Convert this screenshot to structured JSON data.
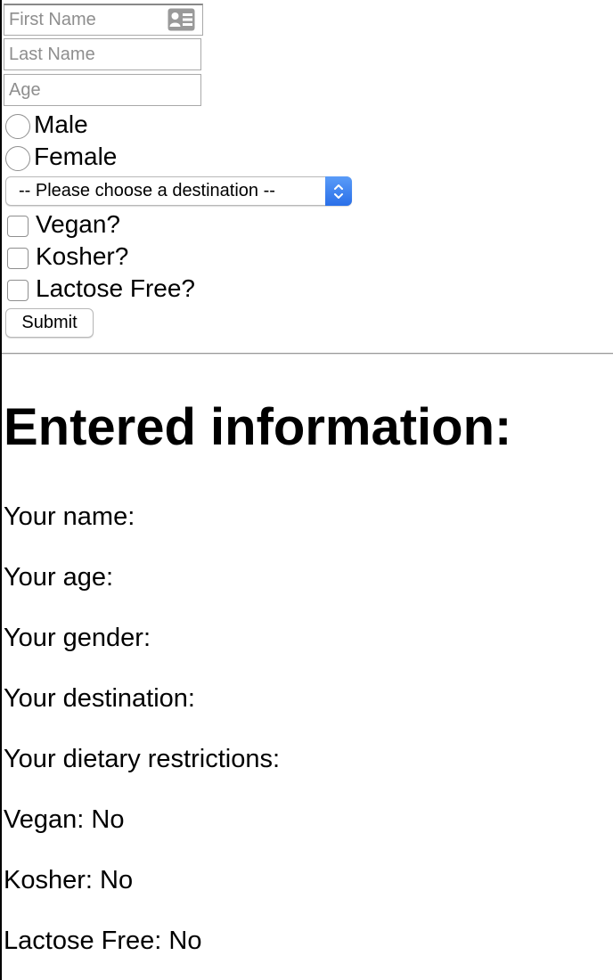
{
  "form": {
    "first_name_placeholder": "First Name",
    "first_name_value": "",
    "last_name_placeholder": "Last Name",
    "last_name_value": "",
    "age_placeholder": "Age",
    "age_value": "",
    "gender_options": [
      "Male",
      "Female"
    ],
    "destination_selected": "-- Please choose a destination --",
    "dietary_options": [
      "Vegan?",
      "Kosher?",
      "Lactose Free?"
    ],
    "submit_label": "Submit",
    "contact_icon": "contact-card-icon"
  },
  "results": {
    "heading": "Entered information:",
    "name_label": "Your name:",
    "age_label": "Your age:",
    "gender_label": "Your gender:",
    "destination_label": "Your destination:",
    "dietary_label": "Your dietary restrictions:",
    "vegan_line": "Vegan: No",
    "kosher_line": "Kosher: No",
    "lactose_line": "Lactose Free: No"
  },
  "colors": {
    "select_accent": "#2f7bf0",
    "input_border": "#a9a9a9",
    "placeholder": "#8e8e8e"
  }
}
